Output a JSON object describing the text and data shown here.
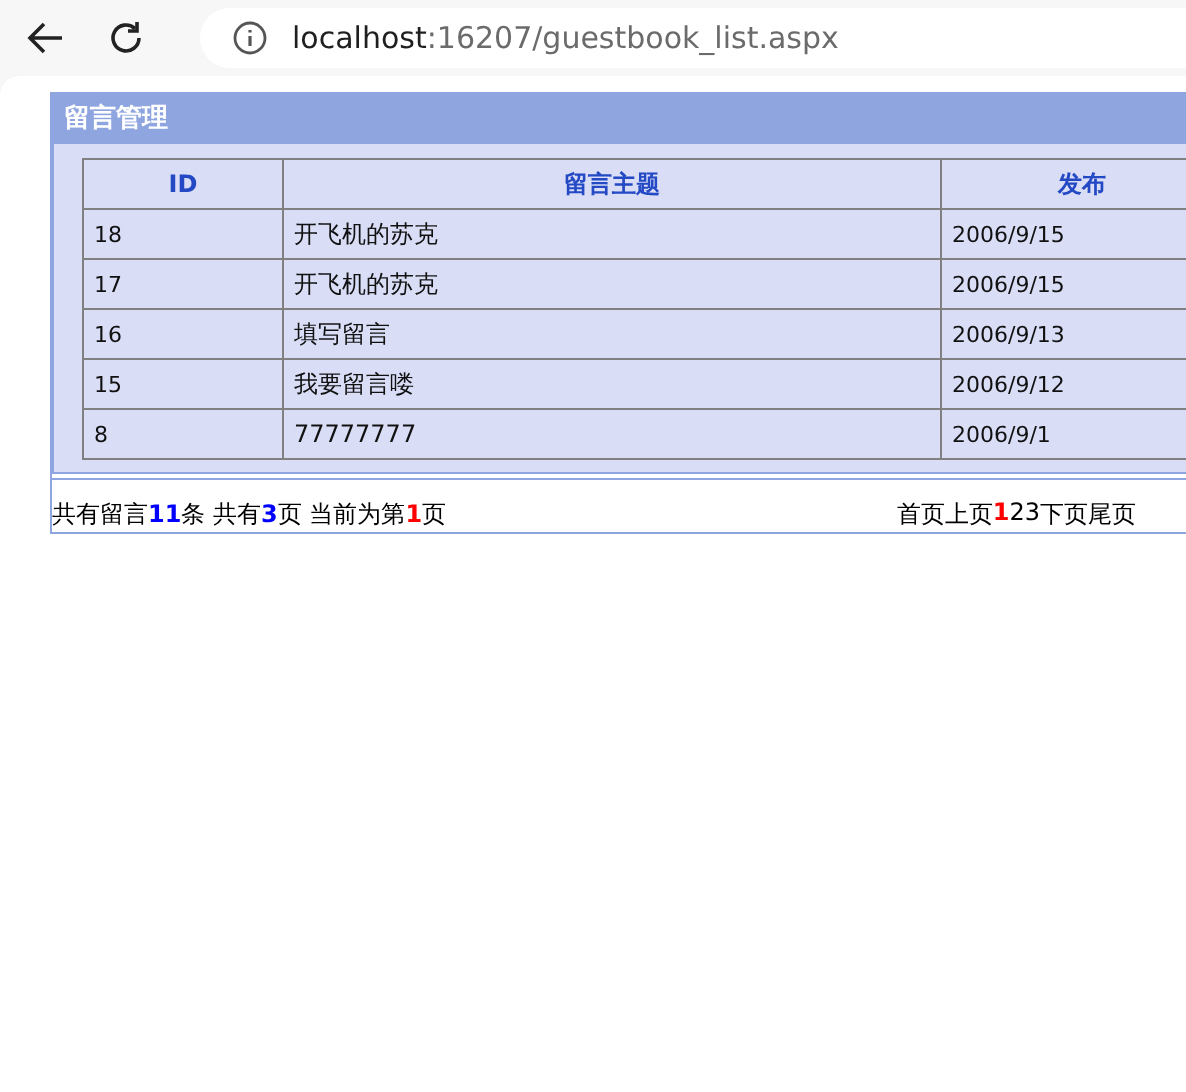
{
  "browser": {
    "url_host": "localhost",
    "url_rest": ":16207/guestbook_list.aspx"
  },
  "panel": {
    "title": "留言管理"
  },
  "table": {
    "columns": [
      "ID",
      "留言主题",
      "发布"
    ],
    "rows": [
      {
        "id": "18",
        "subject": "开飞机的苏克",
        "date": "2006/9/15"
      },
      {
        "id": "17",
        "subject": "开飞机的苏克",
        "date": "2006/9/15"
      },
      {
        "id": "16",
        "subject": "填写留言",
        "date": "2006/9/13"
      },
      {
        "id": "15",
        "subject": "我要留言喽",
        "date": "2006/9/12"
      },
      {
        "id": "8",
        "subject": "77777777",
        "date": "2006/9/1"
      }
    ]
  },
  "summary": [
    {
      "text": "共有留言",
      "kind": "plain"
    },
    {
      "text": "11",
      "kind": "count"
    },
    {
      "text": "条",
      "kind": "plain"
    },
    {
      "text": "共有",
      "kind": "plain"
    },
    {
      "text": "3",
      "kind": "count"
    },
    {
      "text": "页",
      "kind": "plain"
    },
    {
      "text": "当前为第",
      "kind": "plain"
    },
    {
      "text": "1",
      "kind": "current"
    },
    {
      "text": "页",
      "kind": "plain"
    }
  ],
  "pager": {
    "first": "首页",
    "prev": "上页",
    "pages": [
      {
        "label": "1",
        "selected": true
      },
      {
        "label": "2",
        "selected": false
      },
      {
        "label": "3",
        "selected": false
      }
    ],
    "next": "下页",
    "last": "尾页"
  }
}
